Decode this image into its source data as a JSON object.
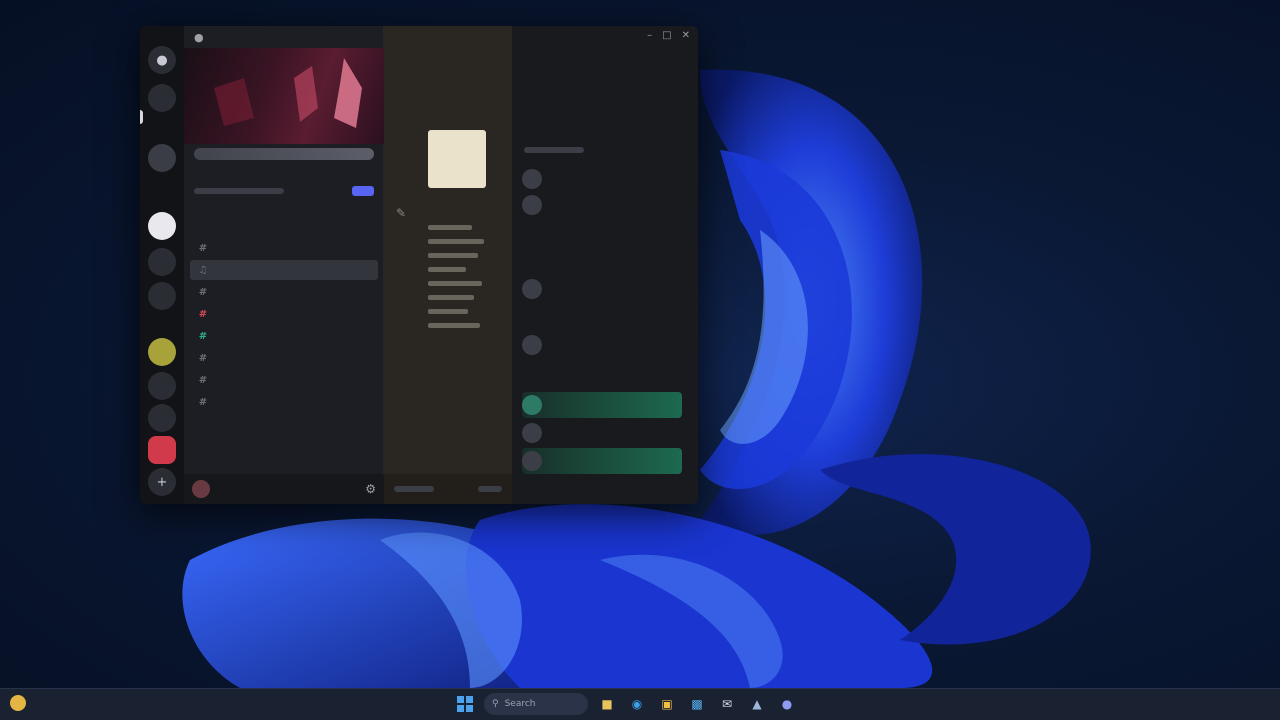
{
  "taskbar": {
    "weather_temp": "",
    "search_placeholder": "Search",
    "clock_time": "",
    "clock_date": "",
    "apps": [
      {
        "icon": "file-explorer-icon"
      },
      {
        "icon": "browser-icon"
      },
      {
        "icon": "folder-icon"
      },
      {
        "icon": "store-icon"
      },
      {
        "icon": "mail-icon"
      },
      {
        "icon": "app-icon"
      },
      {
        "icon": "discord-icon"
      }
    ]
  },
  "app": {
    "server_name": "",
    "channels": [
      {
        "name": "",
        "active": false
      },
      {
        "name": "",
        "active": true
      },
      {
        "name": "",
        "active": false
      },
      {
        "name": "",
        "active": false
      },
      {
        "name": "",
        "active": false
      },
      {
        "name": "",
        "active": false
      },
      {
        "name": "",
        "active": false
      },
      {
        "name": "",
        "active": false
      }
    ],
    "user_name": "",
    "chat_title": "",
    "members": [
      {
        "name": ""
      },
      {
        "name": ""
      },
      {
        "name": ""
      },
      {
        "name": ""
      },
      {
        "name": ""
      },
      {
        "name": ""
      },
      {
        "name": ""
      }
    ]
  },
  "colors": {
    "accent": "#5865f2",
    "wallpaper_blue": "#1f4bff",
    "online_green": "#23a55a"
  }
}
